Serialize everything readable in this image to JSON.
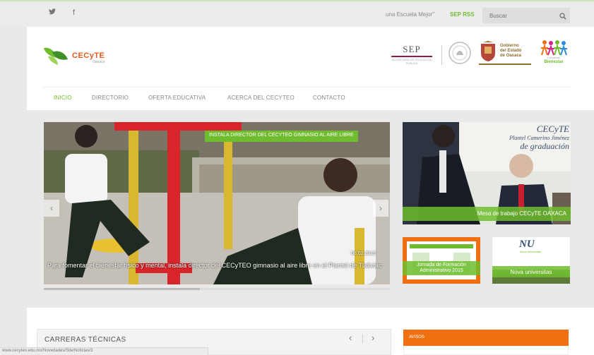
{
  "topbar": {
    "twitter_icon": "twitter-icon",
    "facebook_icon": "facebook-icon",
    "facebook_glyph": "f",
    "tagline": "una Escuela Mejor\"",
    "rss": "SEP RSS",
    "search_placeholder": "Buscar",
    "search_icon": "search-icon"
  },
  "header": {
    "logo_text": "CECyTE",
    "logo_sub": "Oaxaca",
    "sep_text": "SEP",
    "sep_sub": "SECRETARÍA DE EDUCACIÓN PÚBLICA",
    "gobierno_text": [
      "Gobierno",
      "del Estado",
      "de Oaxaca"
    ],
    "bienestar_text": [
      "Creciendo",
      "Bienestar"
    ]
  },
  "nav": {
    "items": [
      {
        "label": "INICIO",
        "active": true
      },
      {
        "label": "DIRECTORIO",
        "active": false
      },
      {
        "label": "OFERTA EDUCATIVA",
        "active": false
      },
      {
        "label": "ACERCA DEL CECYTEO",
        "active": false
      },
      {
        "label": "CONTACTO",
        "active": false
      }
    ]
  },
  "slider": {
    "tag": "INSTALA DIRECTOR DEL CECYTEO GIMNASIO AL AIRE LIBRE",
    "caption": "Para fomentar el bienestar físico y mental, instala director del CECyTEO gimnasio al aire libre en el Plantel de Tlalixtac",
    "date": "08.02.2015",
    "prev_glyph": "‹",
    "next_glyph": "›",
    "progress": 0.45
  },
  "side": {
    "big_caption": "Mesa de trabajo CECyTE OAXACA",
    "big_banner_lines": [
      "CECyTE",
      "Plantel Camerino Jiménez",
      "de graduación"
    ],
    "small1_caption": [
      "Jornada de Formación",
      "Administrativo 2015"
    ],
    "small2_logo": "NU",
    "small2_sub": "Nova Universitas",
    "small2_caption": "Nova universitas"
  },
  "lower": {
    "carreras_title": "CARRERAS TÉCNICAS",
    "carreras_prev": "‹",
    "carreras_next": "›",
    "avisos_title": "AVISOS"
  },
  "status": {
    "url": "www.cecyteo.edu.mx/Novedades/Site/Noticias/3"
  },
  "colors": {
    "accent_green": "#6fbd2e",
    "avisos_orange": "#f07010",
    "logo_orange": "#e05a1c"
  }
}
